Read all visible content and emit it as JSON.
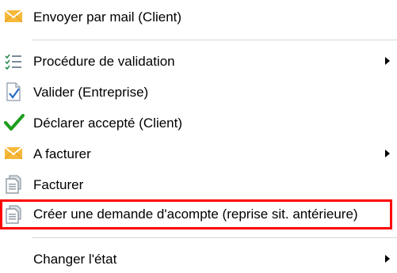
{
  "menu": {
    "items": [
      {
        "label": "Envoyer par mail (Client)",
        "icon": "envelope-icon",
        "submenu": false
      },
      {
        "label": "Procédure de validation",
        "icon": "checklist-icon",
        "submenu": true
      },
      {
        "label": "Valider (Entreprise)",
        "icon": "validate-document-icon",
        "submenu": false
      },
      {
        "label": "Déclarer accepté (Client)",
        "icon": "checkmark-icon",
        "submenu": false
      },
      {
        "label": "A facturer",
        "icon": "envelope-icon",
        "submenu": true
      },
      {
        "label": "Facturer",
        "icon": "invoice-icon",
        "submenu": false
      },
      {
        "label": "Créer une demande d'acompte (reprise sit. antérieure)",
        "icon": "invoice-icon",
        "submenu": false,
        "highlighted": true
      },
      {
        "label": "Changer l'état",
        "icon": "",
        "submenu": true
      }
    ]
  },
  "colors": {
    "highlight_border": "#ff0000",
    "separator": "#d7d7d7",
    "envelope": "#f6b93b",
    "checkmark": "#1e9e1e",
    "checklist": "#2e8b57",
    "validate": "#2b6cc4"
  }
}
